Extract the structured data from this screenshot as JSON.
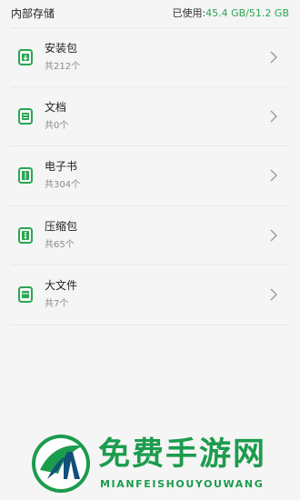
{
  "header": {
    "title": "内部存储",
    "usage_label": "已使用:",
    "usage_value": "45.4 GB/51.2 GB"
  },
  "categories": [
    {
      "name": "安装包",
      "count": "共212个",
      "icon": "apk-icon"
    },
    {
      "name": "文档",
      "count": "共0个",
      "icon": "document-icon"
    },
    {
      "name": "电子书",
      "count": "共304个",
      "icon": "ebook-icon"
    },
    {
      "name": "压缩包",
      "count": "共65个",
      "icon": "archive-icon"
    },
    {
      "name": "大文件",
      "count": "共7个",
      "icon": "large-file-icon"
    }
  ],
  "watermark": {
    "title": "免费手游网",
    "subtitle": "MIANFEISHOUYOUWANG"
  },
  "colors": {
    "accent": "#2aa652",
    "icon_green": "#2aa652",
    "watermark_green": "#1c9c4d"
  }
}
